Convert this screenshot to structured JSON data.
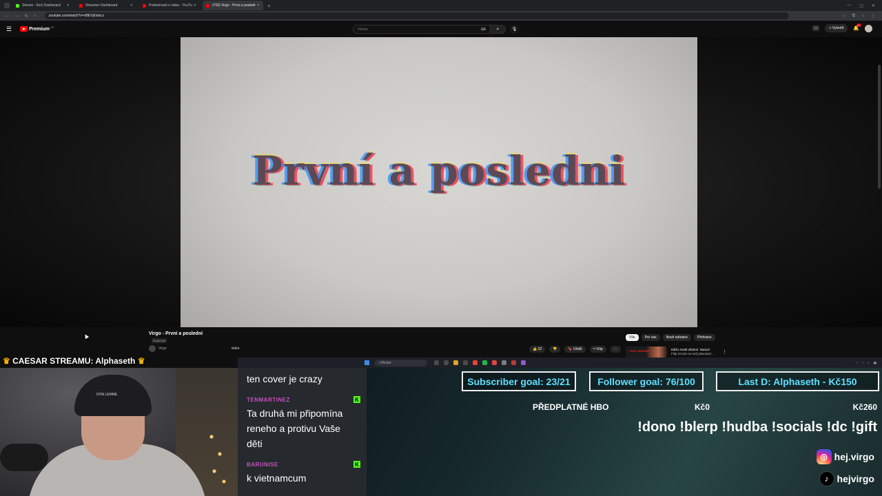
{
  "browser": {
    "tabs": [
      {
        "label": "Stream - Kick Dashboard",
        "color": "#53fc18"
      },
      {
        "label": "Streamer Dashboard",
        "color": "#ff0000"
      },
      {
        "label": "Podrobnosti o videu - YouTube",
        "color": "#ff0000"
      },
      {
        "label": "(703) Virgo - První a posledn",
        "color": "#ff0000",
        "active": true
      }
    ],
    "url": "youtube.com/watch?v=vBEVjXxtoLs"
  },
  "youtube": {
    "brand": "Premium",
    "country": "CZ",
    "search_placeholder": "Hledat",
    "create_label": "Vytvořit",
    "notif_count": "9+",
    "video_overlay_title": "První a posledni",
    "video_title": "Virgo - První a poslední",
    "video_badge": "Soukromé",
    "channel_name": "Virgo",
    "video_label": "video",
    "likes": "22",
    "save_label": "Uložit",
    "clip_label": "Klip",
    "chips": [
      "Vše",
      "Pro vás",
      "Nově nahráno",
      "Přehráno"
    ],
    "rec_title": "Můžu ztratit vědomí. Narazil",
    "rec_sub": "Filip Grznár na svůj absolutní...",
    "rec_thumb": "FILIP GRZNÁR"
  },
  "taskbar": {
    "search_placeholder": "Hledat",
    "app_colors": [
      "#4a4a4a",
      "#4a4a4a",
      "#e2a32a",
      "#4a4a4a",
      "#ea4335",
      "#1db954",
      "#d44",
      "#7d7d7d",
      "#b83a3a",
      "#8a5cc9"
    ]
  },
  "stream": {
    "caesar_label": "CAESAR STREAMU: Alphaseth",
    "webcam_beanie": "DON LEMME",
    "chat": [
      {
        "user": "",
        "text": "ten cover je crazy"
      },
      {
        "user": "TENMARTINEZ",
        "text": "Ta druhá mi připomína reneho a protivu Vaše děti",
        "lines": [
          "Ta druhá mi připomína",
          "reneho a protivu Vaše",
          "děti"
        ],
        "user_color": "#c94fc3"
      },
      {
        "user": "BARUNISE",
        "text": "k vietnamcum",
        "user_color": "#c94fc3"
      }
    ],
    "subscriber_goal": "Subscriber goal: 23/21",
    "follower_goal": "Follower goal: 76/100",
    "last_donation": "Last D: Alphaseth - Kč150",
    "hbo_label": "PŘEDPLATNÉ HBO",
    "hbo_current": "Kč0",
    "hbo_target": "Kč260",
    "commands": "!dono !blerp !hudba !socials !dc !gift",
    "instagram": "hej.virgo",
    "tiktok": "hejvirgo"
  },
  "colors": {
    "accent_cyan": "#5fe0ff",
    "kick_green": "#53fc18",
    "youtube_red": "#ff0000"
  }
}
